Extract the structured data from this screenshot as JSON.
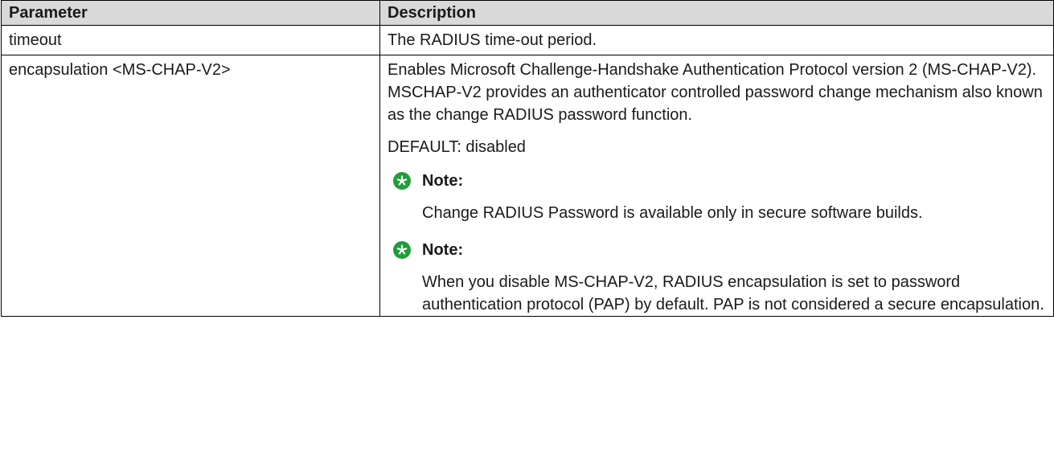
{
  "table": {
    "headers": {
      "parameter": "Parameter",
      "description": "Description"
    },
    "rows": [
      {
        "parameter": "timeout",
        "description": "The RADIUS time-out period."
      },
      {
        "parameter": "encapsulation <MS-CHAP-V2>",
        "description": "Enables Microsoft Challenge-Handshake Authentication Protocol version 2 (MS-CHAP-V2). MSCHAP-V2 provides an authenticator controlled password change mechanism also known as the change RADIUS password function.",
        "default": "DEFAULT: disabled",
        "notes": [
          {
            "icon": "note-star-icon",
            "title": "Note:",
            "text": "Change RADIUS Password is available only in secure software builds."
          },
          {
            "icon": "note-star-icon",
            "title": "Note:",
            "text": "When you disable MS-CHAP-V2, RADIUS encapsulation is set to password authentication protocol (PAP) by default. PAP is not considered a secure encapsulation."
          }
        ]
      }
    ]
  },
  "colors": {
    "header_bg": "#d9d9d9",
    "note_icon": "#1e9e3a",
    "border": "#000000"
  }
}
